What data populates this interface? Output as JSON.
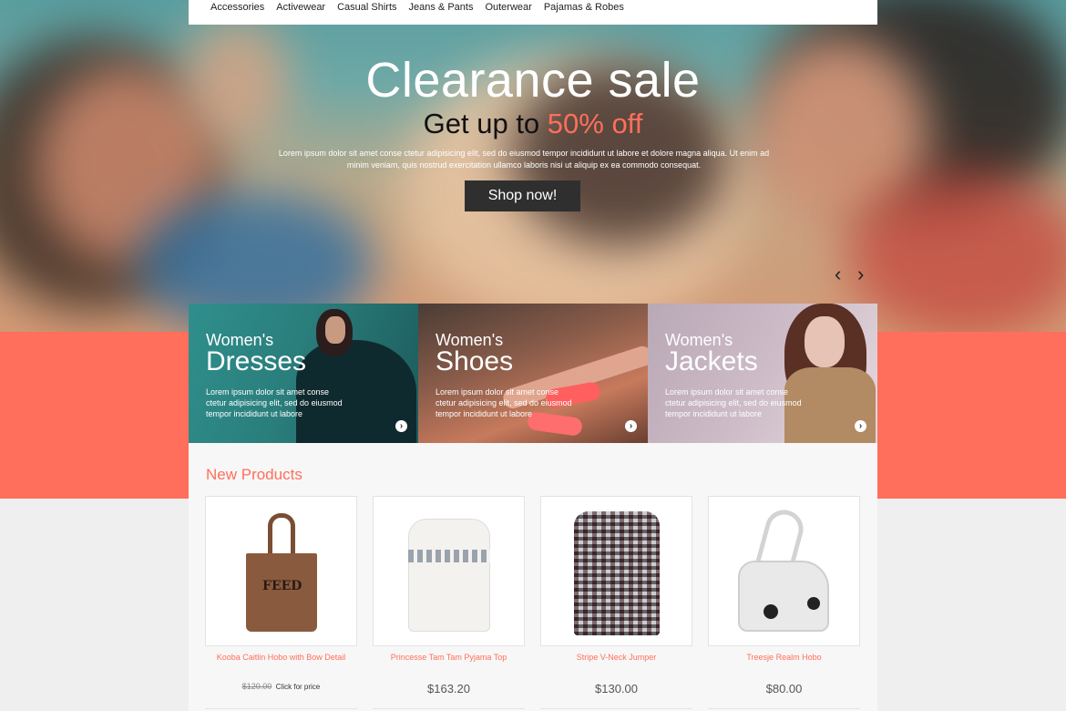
{
  "nav": {
    "items": [
      "Accessories",
      "Activewear",
      "Casual Shirts",
      "Jeans & Pants",
      "Outerwear",
      "Pajamas & Robes"
    ]
  },
  "hero": {
    "title": "Clearance sale",
    "subtitle_prefix": "Get up to ",
    "subtitle_accent": "50% off",
    "description": "Lorem ipsum dolor sit amet conse ctetur adipisicing elit, sed do eiusmod tempor incididunt ut labore et dolore magna aliqua. Ut enim ad minim veniam, quis nostrud exercitation ullamco laboris nisi ut aliquip ex ea commodo consequat.",
    "button_label": "Shop now!",
    "prev_icon": "‹",
    "next_icon": "›"
  },
  "categories": [
    {
      "small": "Women's",
      "big": "Dresses",
      "desc": "Lorem ipsum dolor sit amet conse ctetur adipisicing elit, sed do eiusmod tempor incididunt ut labore"
    },
    {
      "small": "Women's",
      "big": "Shoes",
      "desc": "Lorem ipsum dolor sit amet conse ctetur adipisicing elit, sed do eiusmod tempor incididunt ut labore"
    },
    {
      "small": "Women's",
      "big": "Jackets",
      "desc": "Lorem ipsum dolor sit amet conse ctetur adipisicing elit, sed do eiusmod tempor incididunt ut labore"
    }
  ],
  "products_section": {
    "title": "New Products",
    "items": [
      {
        "name": "Kooba Caitlin Hobo with Bow Detail",
        "old_price": "$120.00",
        "price_note": "Click for price"
      },
      {
        "name": "Princesse Tam Tam Pyjama Top",
        "price": "$163.20"
      },
      {
        "name": "Stripe V-Neck Jumper",
        "price": "$130.00"
      },
      {
        "name": "Treesje Realm Hobo",
        "price": "$80.00"
      }
    ],
    "bag_print": "FEED"
  },
  "colors": {
    "accent": "#ff6f5b",
    "button": "#2f2f2f",
    "page_bg": "#efefef"
  }
}
